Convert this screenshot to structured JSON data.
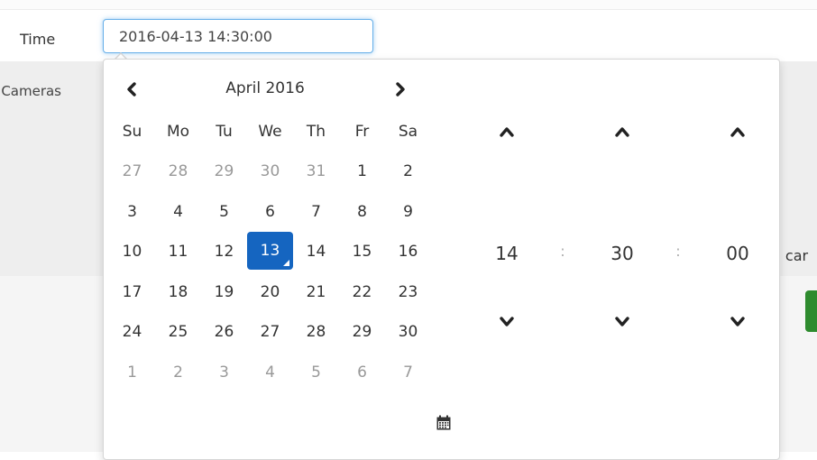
{
  "form": {
    "time_label": "Time",
    "cameras_label": "Cameras",
    "time_value": "2016-04-13 14:30:00",
    "partial_right_text": "e car"
  },
  "picker": {
    "month_label": "April 2016",
    "weekdays": [
      "Su",
      "Mo",
      "Tu",
      "We",
      "Th",
      "Fr",
      "Sa"
    ],
    "weeks": [
      [
        "27",
        "28",
        "29",
        "30",
        "31",
        "1",
        "2"
      ],
      [
        "3",
        "4",
        "5",
        "6",
        "7",
        "8",
        "9"
      ],
      [
        "10",
        "11",
        "12",
        "13",
        "14",
        "15",
        "16"
      ],
      [
        "17",
        "18",
        "19",
        "20",
        "21",
        "22",
        "23"
      ],
      [
        "24",
        "25",
        "26",
        "27",
        "28",
        "29",
        "30"
      ],
      [
        "1",
        "2",
        "3",
        "4",
        "5",
        "6",
        "7"
      ]
    ],
    "selected_day": "13",
    "time": {
      "hours": "14",
      "minutes": "30",
      "seconds": "00",
      "separator": ":"
    },
    "icons": {
      "prev": "chevron-left-icon",
      "next": "chevron-right-icon",
      "up": "chevron-up-icon",
      "down": "chevron-down-icon",
      "calendar": "calendar-icon"
    }
  },
  "colors": {
    "accent": "#1565c0",
    "focus_border": "#66afe9",
    "muted_day": "#999999",
    "success_button": "#2e8b2e"
  }
}
